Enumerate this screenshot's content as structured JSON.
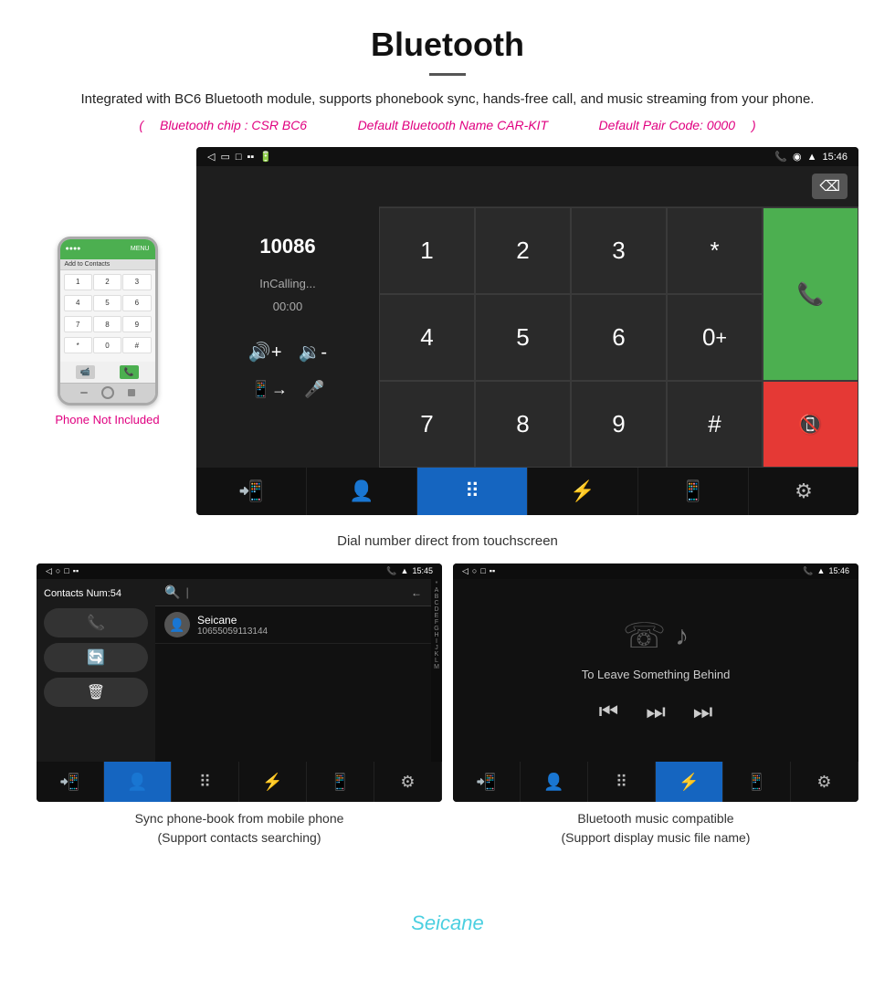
{
  "header": {
    "title": "Bluetooth",
    "description": "Integrated with BC6 Bluetooth module, supports phonebook sync, hands-free call, and music streaming from your phone.",
    "specs": {
      "chip": "Bluetooth chip : CSR BC6",
      "name": "Default Bluetooth Name CAR-KIT",
      "code": "Default Pair Code: 0000"
    }
  },
  "phone_mockup": {
    "label": "Add to Contacts",
    "keys": [
      "1",
      "2",
      "3",
      "4",
      "5",
      "6",
      "7",
      "8",
      "9",
      "*",
      "0",
      "#"
    ],
    "not_included": "Phone Not Included"
  },
  "dial_screen": {
    "status_bar": {
      "time": "15:46",
      "icons": [
        "back",
        "rect",
        "square",
        "signal",
        "lock",
        "wifi"
      ]
    },
    "number": "10086",
    "calling_label": "InCalling...",
    "timer": "00:00",
    "keys": [
      "1",
      "2",
      "3",
      "*",
      "4",
      "5",
      "6",
      "0+",
      "7",
      "8",
      "9",
      "#"
    ],
    "nav_items": [
      "call-forward",
      "person",
      "keypad",
      "bluetooth",
      "phone-out",
      "settings"
    ]
  },
  "dial_caption": "Dial number direct from touchscreen",
  "contacts_screen": {
    "status_bar": {
      "time": "15:45"
    },
    "contacts_num": "Contacts Num:54",
    "contact": {
      "name": "Seicane",
      "phone": "10655059113144"
    },
    "alpha": [
      "*",
      "A",
      "B",
      "C",
      "D",
      "E",
      "F",
      "G",
      "H",
      "I",
      "J",
      "K",
      "L",
      "M"
    ],
    "nav_items": [
      "call",
      "contacts",
      "keypad",
      "bluetooth",
      "phone-out",
      "settings"
    ]
  },
  "contacts_caption": {
    "line1": "Sync phone-book from mobile phone",
    "line2": "(Support contacts searching)"
  },
  "music_screen": {
    "status_bar": {
      "time": "15:46"
    },
    "song_title": "To Leave Something Behind",
    "controls": [
      "prev",
      "play-pause",
      "next"
    ],
    "nav_items": [
      "call",
      "person",
      "keypad",
      "bluetooth",
      "phone-out",
      "settings"
    ]
  },
  "music_caption": {
    "line1": "Bluetooth music compatible",
    "line2": "(Support display music file name)"
  }
}
